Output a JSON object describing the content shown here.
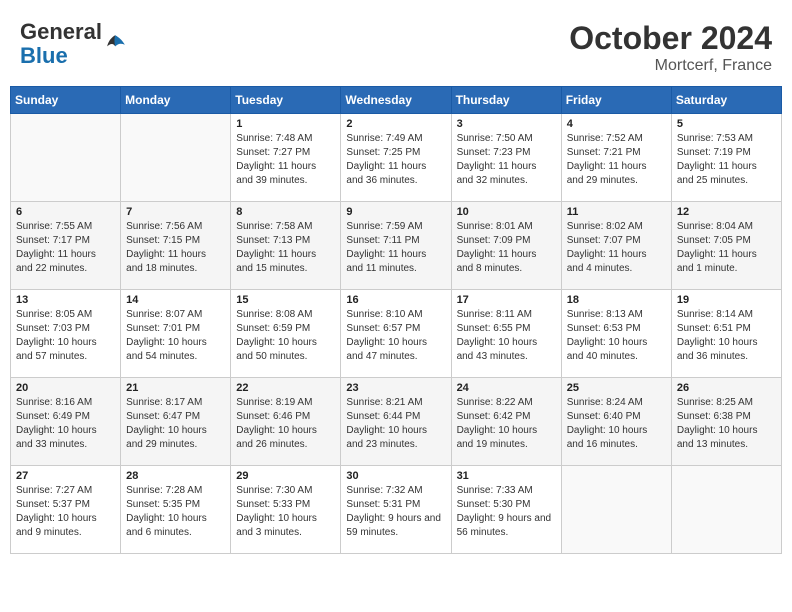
{
  "header": {
    "logo_general": "General",
    "logo_blue": "Blue",
    "month": "October 2024",
    "location": "Mortcerf, France"
  },
  "days_of_week": [
    "Sunday",
    "Monday",
    "Tuesday",
    "Wednesday",
    "Thursday",
    "Friday",
    "Saturday"
  ],
  "weeks": [
    [
      {
        "day": "",
        "detail": ""
      },
      {
        "day": "",
        "detail": ""
      },
      {
        "day": "1",
        "detail": "Sunrise: 7:48 AM\nSunset: 7:27 PM\nDaylight: 11 hours and 39 minutes."
      },
      {
        "day": "2",
        "detail": "Sunrise: 7:49 AM\nSunset: 7:25 PM\nDaylight: 11 hours and 36 minutes."
      },
      {
        "day": "3",
        "detail": "Sunrise: 7:50 AM\nSunset: 7:23 PM\nDaylight: 11 hours and 32 minutes."
      },
      {
        "day": "4",
        "detail": "Sunrise: 7:52 AM\nSunset: 7:21 PM\nDaylight: 11 hours and 29 minutes."
      },
      {
        "day": "5",
        "detail": "Sunrise: 7:53 AM\nSunset: 7:19 PM\nDaylight: 11 hours and 25 minutes."
      }
    ],
    [
      {
        "day": "6",
        "detail": "Sunrise: 7:55 AM\nSunset: 7:17 PM\nDaylight: 11 hours and 22 minutes."
      },
      {
        "day": "7",
        "detail": "Sunrise: 7:56 AM\nSunset: 7:15 PM\nDaylight: 11 hours and 18 minutes."
      },
      {
        "day": "8",
        "detail": "Sunrise: 7:58 AM\nSunset: 7:13 PM\nDaylight: 11 hours and 15 minutes."
      },
      {
        "day": "9",
        "detail": "Sunrise: 7:59 AM\nSunset: 7:11 PM\nDaylight: 11 hours and 11 minutes."
      },
      {
        "day": "10",
        "detail": "Sunrise: 8:01 AM\nSunset: 7:09 PM\nDaylight: 11 hours and 8 minutes."
      },
      {
        "day": "11",
        "detail": "Sunrise: 8:02 AM\nSunset: 7:07 PM\nDaylight: 11 hours and 4 minutes."
      },
      {
        "day": "12",
        "detail": "Sunrise: 8:04 AM\nSunset: 7:05 PM\nDaylight: 11 hours and 1 minute."
      }
    ],
    [
      {
        "day": "13",
        "detail": "Sunrise: 8:05 AM\nSunset: 7:03 PM\nDaylight: 10 hours and 57 minutes."
      },
      {
        "day": "14",
        "detail": "Sunrise: 8:07 AM\nSunset: 7:01 PM\nDaylight: 10 hours and 54 minutes."
      },
      {
        "day": "15",
        "detail": "Sunrise: 8:08 AM\nSunset: 6:59 PM\nDaylight: 10 hours and 50 minutes."
      },
      {
        "day": "16",
        "detail": "Sunrise: 8:10 AM\nSunset: 6:57 PM\nDaylight: 10 hours and 47 minutes."
      },
      {
        "day": "17",
        "detail": "Sunrise: 8:11 AM\nSunset: 6:55 PM\nDaylight: 10 hours and 43 minutes."
      },
      {
        "day": "18",
        "detail": "Sunrise: 8:13 AM\nSunset: 6:53 PM\nDaylight: 10 hours and 40 minutes."
      },
      {
        "day": "19",
        "detail": "Sunrise: 8:14 AM\nSunset: 6:51 PM\nDaylight: 10 hours and 36 minutes."
      }
    ],
    [
      {
        "day": "20",
        "detail": "Sunrise: 8:16 AM\nSunset: 6:49 PM\nDaylight: 10 hours and 33 minutes."
      },
      {
        "day": "21",
        "detail": "Sunrise: 8:17 AM\nSunset: 6:47 PM\nDaylight: 10 hours and 29 minutes."
      },
      {
        "day": "22",
        "detail": "Sunrise: 8:19 AM\nSunset: 6:46 PM\nDaylight: 10 hours and 26 minutes."
      },
      {
        "day": "23",
        "detail": "Sunrise: 8:21 AM\nSunset: 6:44 PM\nDaylight: 10 hours and 23 minutes."
      },
      {
        "day": "24",
        "detail": "Sunrise: 8:22 AM\nSunset: 6:42 PM\nDaylight: 10 hours and 19 minutes."
      },
      {
        "day": "25",
        "detail": "Sunrise: 8:24 AM\nSunset: 6:40 PM\nDaylight: 10 hours and 16 minutes."
      },
      {
        "day": "26",
        "detail": "Sunrise: 8:25 AM\nSunset: 6:38 PM\nDaylight: 10 hours and 13 minutes."
      }
    ],
    [
      {
        "day": "27",
        "detail": "Sunrise: 7:27 AM\nSunset: 5:37 PM\nDaylight: 10 hours and 9 minutes."
      },
      {
        "day": "28",
        "detail": "Sunrise: 7:28 AM\nSunset: 5:35 PM\nDaylight: 10 hours and 6 minutes."
      },
      {
        "day": "29",
        "detail": "Sunrise: 7:30 AM\nSunset: 5:33 PM\nDaylight: 10 hours and 3 minutes."
      },
      {
        "day": "30",
        "detail": "Sunrise: 7:32 AM\nSunset: 5:31 PM\nDaylight: 9 hours and 59 minutes."
      },
      {
        "day": "31",
        "detail": "Sunrise: 7:33 AM\nSunset: 5:30 PM\nDaylight: 9 hours and 56 minutes."
      },
      {
        "day": "",
        "detail": ""
      },
      {
        "day": "",
        "detail": ""
      }
    ]
  ]
}
